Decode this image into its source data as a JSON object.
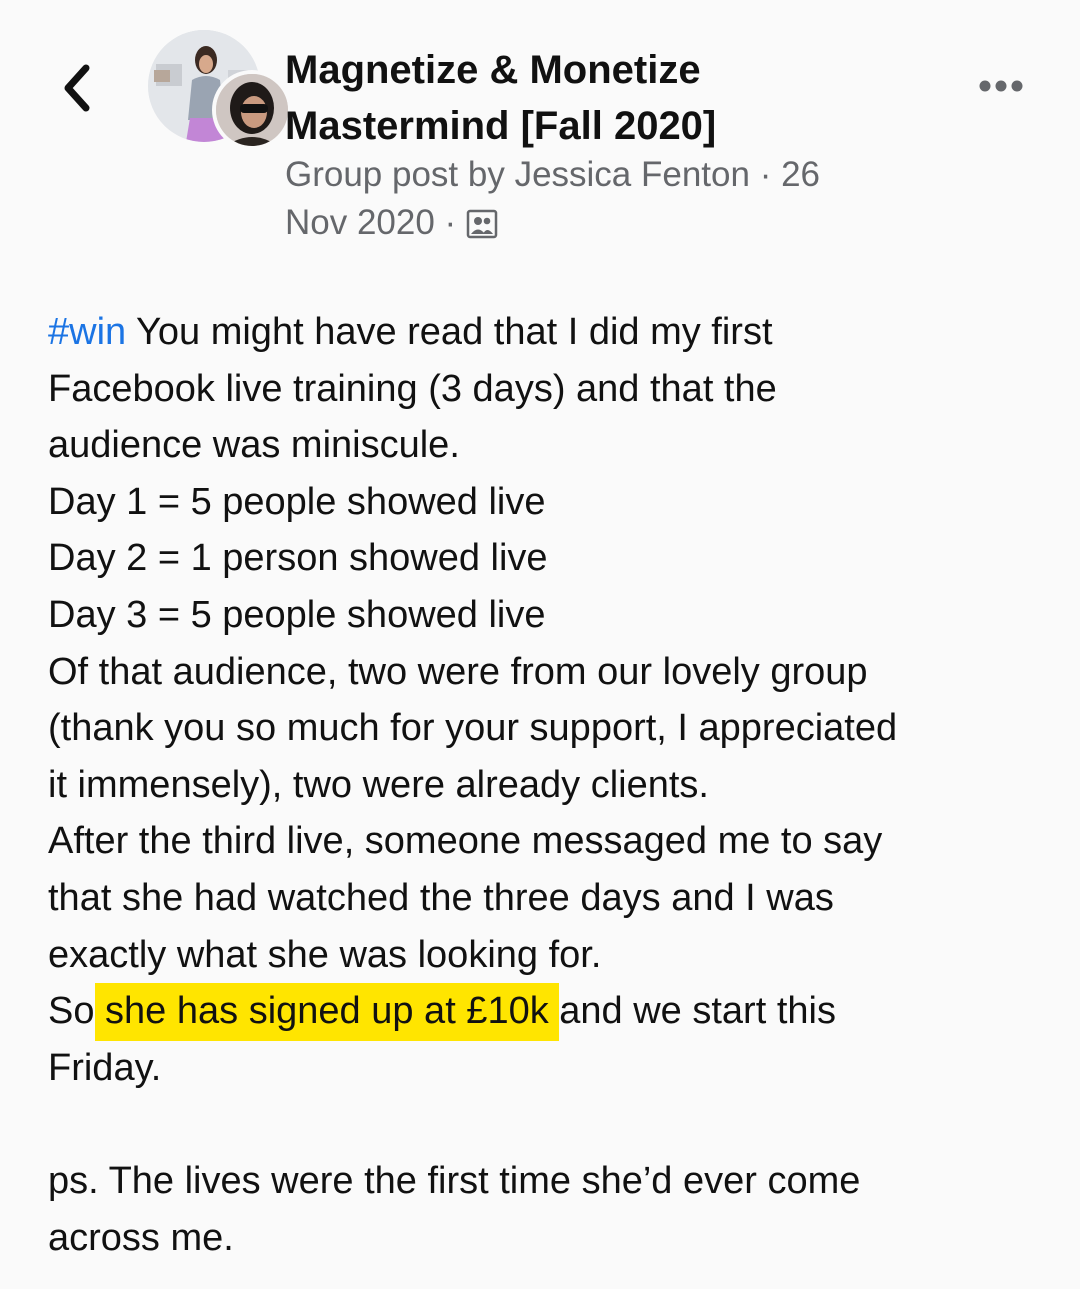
{
  "header": {
    "group_name_line1": "Magnetize & Monetize",
    "group_name_line2": "Mastermind [Fall 2020]",
    "meta_line1": "Group post by Jessica Fenton · 26",
    "meta_line2": "Nov 2020 ·",
    "icons": {
      "back": "chevron-left-icon",
      "more": "more-horizontal-icon",
      "audience": "group-audience-icon"
    }
  },
  "post": {
    "hashtag": "#win",
    "lines": [
      " You might have read that I did my first",
      "Facebook live training (3 days) and that the",
      "audience was miniscule.",
      "Day 1 = 5 people showed live",
      "Day 2 = 1 person showed live",
      "Day 3 = 5 people showed live",
      "Of that audience, two were from our lovely group",
      "(thank you so much for your support, I appreciated",
      "it immensely), two were already clients.",
      "After the third live, someone messaged me to say",
      "that she had watched the three days and I was",
      "exactly what she was looking for.",
      "So ",
      "she has signed up at £10k",
      " and we start this",
      "Friday.",
      "ps. The lives were the first time she’d ever come",
      "across me."
    ]
  },
  "colors": {
    "background": "#fafafa",
    "hashtag": "#1b74e4",
    "highlight": "#ffe500",
    "meta_text": "#65676b"
  }
}
